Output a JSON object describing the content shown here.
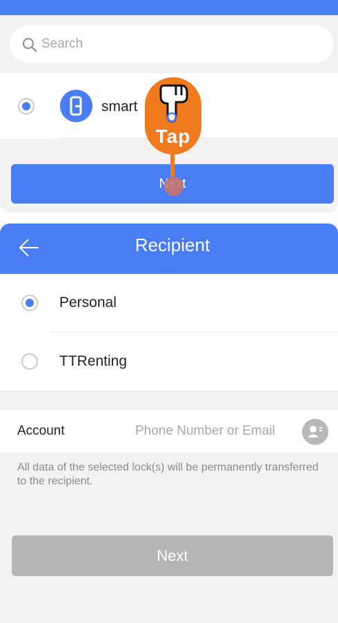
{
  "search": {
    "placeholder": "Search"
  },
  "lock_list": {
    "items": [
      {
        "name": "smart",
        "selected": true
      }
    ],
    "next_label": "Next"
  },
  "tap_overlay": {
    "label": "Tap"
  },
  "recipient": {
    "title": "Recipient",
    "options": [
      {
        "label": "Personal",
        "selected": true
      },
      {
        "label": "TTRenting",
        "selected": false
      }
    ],
    "account_label": "Account",
    "account_placeholder": "Phone Number or Email",
    "note": "All data of the selected lock(s) will be permanently transferred to the recipient.",
    "next_label": "Next"
  },
  "colors": {
    "accent": "#4a7cf4",
    "tap_orange": "#f07a1e",
    "disabled_button": "#b5b5b5",
    "background": "#f2f2f2"
  },
  "icons": [
    "search-icon",
    "lock-icon",
    "pointing-hand-icon",
    "back-arrow-icon",
    "contact-book-icon"
  ]
}
